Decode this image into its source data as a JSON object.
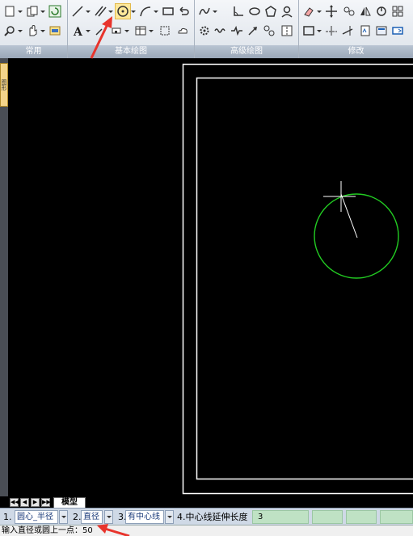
{
  "ribbon": {
    "panels": [
      "常用",
      "基本绘图",
      "高级绘图",
      "修改"
    ]
  },
  "left_panel": {
    "tab_label": "图形"
  },
  "layout_tabs": {
    "model": "模型",
    "nav": [
      "◀◀",
      "◀",
      "▶",
      "▶▶"
    ]
  },
  "options_bar": {
    "opt1_label": "1.",
    "opt1_value": "圆心_半径",
    "opt2_label": "2.",
    "opt2_value": "直径",
    "opt3_label": "3.",
    "opt3_value": "有中心线",
    "opt4_label": "4.中心线延伸长度",
    "opt4_value": "3"
  },
  "command_line": {
    "prompt": "输入直径或圆上一点：50"
  },
  "colors": {
    "circle": "#22cc22",
    "crosshair": "#ffffff",
    "annotation": "#e8342c",
    "active_tool": "#fde89a"
  }
}
